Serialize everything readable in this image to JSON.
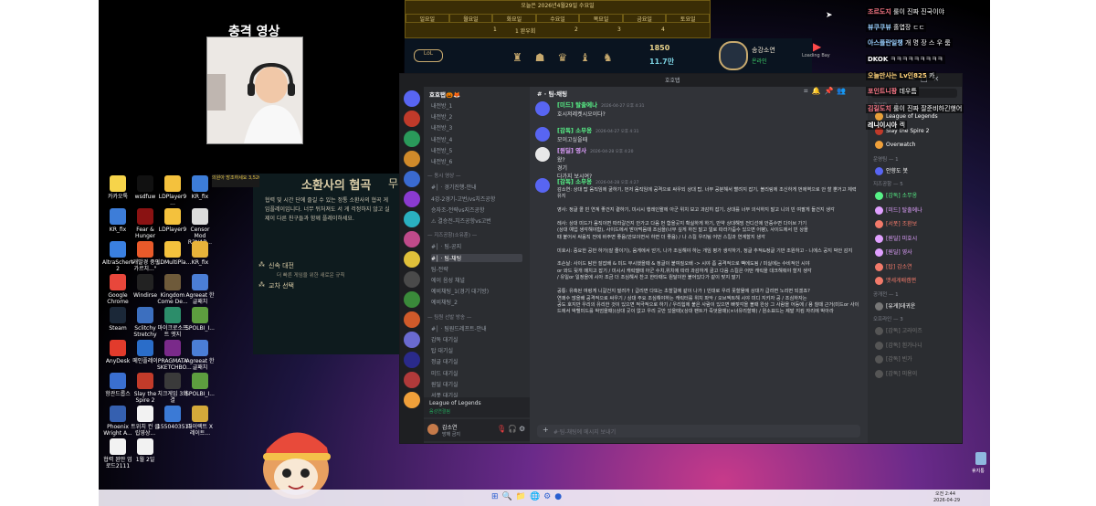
{
  "webcam": {
    "title": "충격 영상"
  },
  "calendar": {
    "title": "오늘은 2026년4월29일 수요일",
    "days": [
      "일요일",
      "월요일",
      "화요일",
      "수요일",
      "목요일",
      "금요일",
      "토요일"
    ],
    "row": [
      "1",
      "1 완우회",
      "2",
      "3",
      "4"
    ]
  },
  "lol_bar": {
    "rp": "1850",
    "be": "11.7만",
    "name": "송강소연",
    "status": "온라인"
  },
  "game_overlay": {
    "title": "소환사의 협곡",
    "desc": "협력 및 시간 단에 즐길 수 있는 정통 소환사의 협곡 게임플레이입니다. 너무 뒤처져도 서 게 걱정하지 않고 실제이 다른 친구들과 함께 플레이하세요.",
    "option1": "신속 대전",
    "option1_sub": "더 빠른 게임을 위한 새로운 규칙",
    "option2": "교차 선택",
    "side_text": "무",
    "tab": "의원아 방조하세요 3,520 캐시 장터"
  },
  "desktop_icons": [
    {
      "label": "카카오톡",
      "color": "#f6d44a"
    },
    {
      "label": "wsdfuw",
      "color": "#111"
    },
    {
      "label": "LDPlayer9 ...",
      "color": "#f4c13d"
    },
    {
      "label": "KR_fix",
      "color": "#3d7dd8"
    },
    {
      "label": "KR_fix",
      "color": "#3d7dd8"
    },
    {
      "label": "Fear & Hunger",
      "color": "#8a1212"
    },
    {
      "label": "LDPlayer9",
      "color": "#f4c13d"
    },
    {
      "label": "Censor Mod R2t/AR...",
      "color": "#dcdcdc"
    },
    {
      "label": "AltraSchere 2",
      "color": "#3a80e0"
    },
    {
      "label": "\"개발경 중인 가르치...\"",
      "color": "#e85a2a"
    },
    {
      "label": "LDMultiPla...",
      "color": "#f4c13d"
    },
    {
      "label": "KR_fix",
      "color": "#e8b33a"
    },
    {
      "label": "Google Chrome",
      "color": "#e8473b"
    },
    {
      "label": "Windirse",
      "color": "#222"
    },
    {
      "label": "Kingdom Come De...",
      "color": "#6e5a3a"
    },
    {
      "label": "Agreeat 한글패치",
      "color": "#4b7ed6"
    },
    {
      "label": "Steam",
      "color": "#1b2838"
    },
    {
      "label": "Sclitchy Stretchy",
      "color": "#3c6fbf"
    },
    {
      "label": "마이크로소프트 엣지",
      "color": "#2c8d6a"
    },
    {
      "label": "SPOLBI_I...",
      "color": "#5d9e3f"
    },
    {
      "label": "AnyDesk",
      "color": "#e23b2c"
    },
    {
      "label": "메인플레이",
      "color": "#2a6dc9"
    },
    {
      "label": "PRAGMATA SKETCHBO...",
      "color": "#7a2a8a"
    },
    {
      "label": "Agreeat 한글패치",
      "color": "#4b7ed6"
    },
    {
      "label": "항관드롭스",
      "color": "#3a6fd0"
    },
    {
      "label": "Slay the Spire 2",
      "color": "#c23b2a"
    },
    {
      "label": "치크게임 3회결",
      "color": "#3a3a3a"
    },
    {
      "label": "SPOLBI_I...",
      "color": "#5d9e3f"
    },
    {
      "label": "Phoenix Wright A...",
      "color": "#3560b0"
    },
    {
      "label": "트위치 컨 클립영상...",
      "color": "#f2f2f2"
    },
    {
      "label": "1550403515",
      "color": "#3b7ad6"
    },
    {
      "label": "다이렉트 X 레이트...",
      "color": "#d4a93a"
    },
    {
      "label": "협력 완만 업로드2111",
      "color": "#f2f2f2"
    },
    {
      "label": "1월 2일",
      "color": "#f2f2f2"
    }
  ],
  "discord": {
    "title": "호호탭",
    "server_name": "호호탭🎃🦊",
    "channels": [
      {
        "kind": "ch",
        "text": "내전방_1"
      },
      {
        "kind": "ch",
        "text": "내전방_2"
      },
      {
        "kind": "ch",
        "text": "내전방_3"
      },
      {
        "kind": "ch",
        "text": "내전방_4"
      },
      {
        "kind": "ch",
        "text": "내전방_5"
      },
      {
        "kind": "ch",
        "text": "내전방_6"
      },
      {
        "kind": "cat",
        "text": "— 동시 영상 —"
      },
      {
        "kind": "ch",
        "text": "#│ · 경기진행-안내"
      },
      {
        "kind": "ch",
        "text": "4강-2경기-고번/vs치즈공항"
      },
      {
        "kind": "ch",
        "text": "승자조-전략vs지즈공항"
      },
      {
        "kind": "ch",
        "text": "⚠ 결승전-치즈공항vs고번"
      },
      {
        "kind": "cat",
        "text": "— 지즈공항(소유훈) —"
      },
      {
        "kind": "ch",
        "text": "#│ · 팀-공지"
      },
      {
        "kind": "ch",
        "text": "#│ · 팀-채팅",
        "sel": true
      },
      {
        "kind": "ch",
        "text": "팀-전략"
      },
      {
        "kind": "ch",
        "text": "에이 음성 채널"
      },
      {
        "kind": "ch",
        "text": "예비채팅_1(경기 대기방)"
      },
      {
        "kind": "ch",
        "text": "예비채팅_2"
      },
      {
        "kind": "cat",
        "text": "— 팀원 선발 방송 —"
      },
      {
        "kind": "ch",
        "text": "#│ · 팀원드레프트-안내"
      },
      {
        "kind": "ch",
        "text": "감독 대기실"
      },
      {
        "kind": "ch",
        "text": "탑 대기실"
      },
      {
        "kind": "ch",
        "text": "정글 대기실"
      },
      {
        "kind": "ch",
        "text": "미드 대기실"
      },
      {
        "kind": "ch",
        "text": "원딜 대기실"
      },
      {
        "kind": "ch",
        "text": "서폿 대기실"
      }
    ],
    "channel_header": "# · 팀-채팅",
    "messages": [
      {
        "author": "[미드] 탈출에나",
        "color": "#57f287",
        "time": "2026-04-27 오후 4:31",
        "text": "호시저레켓시오이다?"
      },
      {
        "author": "[감독] 소무옹",
        "color": "#57f287",
        "time": "2026-04-27 오후 4:31",
        "text": "모이고싶을때"
      },
      {
        "author": "[원딜] 영사",
        "color": "#e0a0ff",
        "time": "2026-04-28 오후 4:20",
        "text": "왔?\n경기\n다가지 보시여?"
      },
      {
        "author": "[감독] 소무옹",
        "color": "#57f287",
        "time": "2026-04-28 오후 4:27",
        "text": "감소연: 상대 탑 움직임에 굴하기, 먼저 움직임에 공격으로 싸우되 상대 탑, 너무 공분해서 빨려지 잡기, 볼리링에 조신하게 번에역으로 안 할 뿐거고 체력 유지\n\n영사: 정글 콜 빈 연계 좋건지 곁하기, 미시시 행레인왈에 아군 위치 보고 과감히 잡기, 상대를 너무 의식하지 말고 니의 빈 여팔게 들건지 생각\n\n레사: 상대 미드가 움직이면 따라갈건지 안가고 다음 번 합을곳지 확실하게 하기, 만약 상대해밍 전디선에 안중수면 다이브 가기\n(상대 예업 생각해야함), 사이드에서 받아먹음때 조심을(너무 깊게 하진 말고 얼로 따라가줌수 있으면 어팽), 사이드에서 빈 상을\n때 붙어서 싸움직 전에 바주면 좋음(만보이면서 하면 더 좋음) / 나 스킬 우리팀 어떤 스킬과 연계할지 생각\n\n미호시: 중요한 공반 하가(잘 줄이기), 움게에서 얻기, 나가 조심해야 하는 개임 평가 생각하기, 정글 추적&정글 기반 조원하고 - 니에스 공지 박안 감지\n\n조손날: 사이드 탐한 잘잡배 & 미드 무시했을때 & 정글이 붙여질오배 -> 시야 좀 공격적으로 빽에도됨 / 미실에는 수비적인 시야\nor 와드 뒷개 매치고 잡기 / 미시시 캐릭델때 아군 수치,위치에 따라 과감하게 골고 다음 스킬은 어떤 캐릭을 대크해줘야 할지 생각\n/ 유일or 일정을에 시아 조금 더 조심해서 찬고 한타때도 원달이한 붙어있다가 같이 맞지 말기\n\n공통: 유혹된 여렁게 니갈건지 밑려가 ( 급리면 다또는 초할걸에 같이 나가 ) 빈대로 우리 못할물에 상대가 급리면 노리면 되겠죠?\n연쾌수 많을배 공격적으로 싸우기 / 상대 주요 조심해야하는 캐릭터를 위치 파악 / 오브젝트해 시야 미디 지키자 공 / 조심하자는\n공도 호지만 우리의 유리한 것이 있으면 적극적으로 하기 / 우리힘에 붙은 사람이 있으면 빠젖각을 볼때 완상 그 사람을 어등에 / 용 칠때 근거(미드or 사이드에서 박헬미드를 박엄을때)(상대 곳이 없고 우리 곳만 있을때)(상대 팬트가 죽엇을때)(×너유리할때) / 원소표드는 제발 지킴 자리에 박아라"
      }
    ],
    "members": [
      {
        "kind": "cat",
        "text": "관리자 — 1"
      },
      {
        "kind": "m",
        "text": "League of Legends",
        "color": "#fff"
      },
      {
        "kind": "m",
        "text": "Slay the Spire 2",
        "color": "#fff"
      },
      {
        "kind": "m",
        "text": "Overwatch",
        "color": "#fff"
      },
      {
        "kind": "cat",
        "text": "운영팀 — 1"
      },
      {
        "kind": "m",
        "text": "안향도 봇",
        "color": "#fff"
      },
      {
        "kind": "cat",
        "text": "지즈공항 — 5"
      },
      {
        "kind": "m",
        "text": "[감독] 소무옹",
        "color": "#57f287"
      },
      {
        "kind": "m",
        "text": "[미드] 탈출에나",
        "color": "#e0a0ff"
      },
      {
        "kind": "m",
        "text": "[서폿] 조환보",
        "color": "#f27a6a"
      },
      {
        "kind": "m",
        "text": "[원딜] 미호시",
        "color": "#e0a0ff"
      },
      {
        "kind": "m",
        "text": "[원딜] 영사",
        "color": "#e0a0ff"
      },
      {
        "kind": "m",
        "text": "[탑] 감소연",
        "color": "#f27a6a"
      },
      {
        "kind": "m",
        "text": "맷세게배캠편",
        "color": "#f27a6a"
      },
      {
        "kind": "cat",
        "text": "공개전 — 1"
      },
      {
        "kind": "m",
        "text": "[유게]데귀운",
        "color": "#fff"
      },
      {
        "kind": "cat",
        "text": "오프라인 — 3"
      },
      {
        "kind": "m",
        "text": "[감독] 고라이즈",
        "color": "#777"
      },
      {
        "kind": "m",
        "text": "[감독] 흰가나니",
        "color": "#777"
      },
      {
        "kind": "m",
        "text": "[감독] 빈가",
        "color": "#777"
      },
      {
        "kind": "m",
        "text": "[감독] 미용이",
        "color": "#777"
      }
    ],
    "input_placeholder": "#·팀-채팅에 메시지 보내기",
    "server_card": {
      "name": "League of Legends",
      "sub": "음성연결됨"
    },
    "user": {
      "name": "감소연",
      "status": "방해 금지"
    }
  },
  "twitch_chat": [
    {
      "name": "조르도지",
      "color": "#ff7a8a",
      "text": "룰이 진짜 진국이야"
    },
    {
      "name": "뷰쿠쿠뷰",
      "color": "#9ad0ff",
      "text": "홀엽장 ㄷㄷ"
    },
    {
      "name": "아스플란일챙",
      "color": "#9ad0ff",
      "text": "개 명 장 스 우 룸"
    },
    {
      "name": "DKOK",
      "color": "#ffffff",
      "text": "ㅋㅋㅋㅋㅋㅋㅋㅋㅋ"
    },
    {
      "name": "오늘만사는 Lv인825",
      "color": "#ffd27a",
      "text": "카"
    },
    {
      "name": "포인트니팡",
      "color": "#ff7a8a",
      "text": "데우틈"
    },
    {
      "name": "김길도치",
      "color": "#ff7a8a",
      "text": "룰이 진짜 잘준비하긴햇어"
    },
    {
      "name": "레니이시아",
      "color": "#ffffff",
      "text": "켁"
    }
  ],
  "system": {
    "time": "오전 2:44",
    "date": "2026-04-29",
    "recycle": "휴지통"
  }
}
